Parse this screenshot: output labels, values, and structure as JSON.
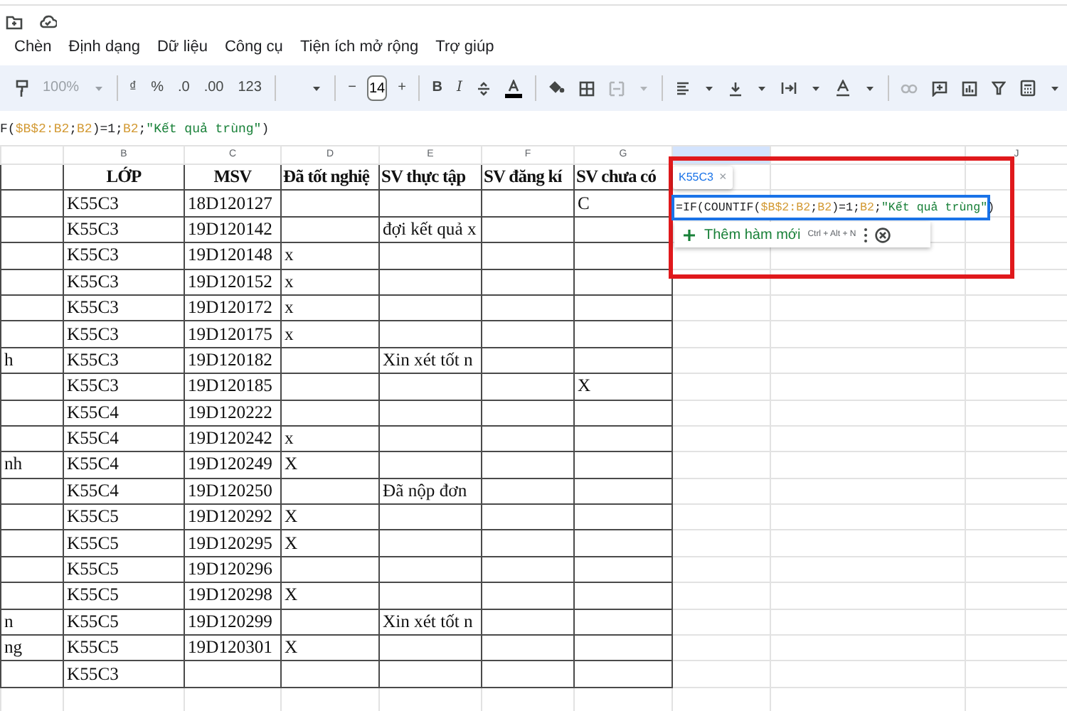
{
  "menu": [
    "Chèn",
    "Định dạng",
    "Dữ liệu",
    "Công cụ",
    "Tiện ích mở rộng",
    "Trợ giúp"
  ],
  "toolbar": {
    "zoom": "100%",
    "currency": "₫",
    "percent": "%",
    "decimal_decrease": ".0",
    "decimal_increase": ".00",
    "number_format": "123",
    "font_size_minus": "−",
    "font_size": "14",
    "font_size_plus": "+",
    "bold": "B",
    "italic": "I"
  },
  "formula_bar": {
    "segments": [
      {
        "kind": "plain",
        "text": "F("
      },
      {
        "kind": "ref",
        "text": "$B$2:B2"
      },
      {
        "kind": "plain",
        "text": ";"
      },
      {
        "kind": "ref",
        "text": "B2"
      },
      {
        "kind": "plain",
        "text": ")=1;"
      },
      {
        "kind": "ref",
        "text": "B2"
      },
      {
        "kind": "plain",
        "text": ";"
      },
      {
        "kind": "string",
        "text": "\"Kết quả trùng\""
      },
      {
        "kind": "plain",
        "text": ")"
      }
    ]
  },
  "column_headers": [
    {
      "letter": "B",
      "selected": false
    },
    {
      "letter": "C",
      "selected": false
    },
    {
      "letter": "D",
      "selected": false
    },
    {
      "letter": "E",
      "selected": false
    },
    {
      "letter": "F",
      "selected": false
    },
    {
      "letter": "G",
      "selected": false
    },
    {
      "selected": true
    },
    {
      "selected": false
    },
    {
      "letter": "J",
      "selected": false
    }
  ],
  "table": {
    "columns": [
      "LỚP",
      "MSV",
      "Đã tốt nghiệ",
      "SV thực tập",
      "SV đăng kí",
      "SV chưa có"
    ],
    "rows": [
      {
        "class": "K55C3",
        "msv": "18D120127",
        "column_7": "C"
      },
      {
        "class": "K55C3",
        "msv": "19D120142",
        "column_5": "đợi kết quả x"
      },
      {
        "class": "K55C3",
        "msv": "19D120148",
        "column_4": "x"
      },
      {
        "class": "K55C3",
        "msv": "19D120152",
        "column_4": "x"
      },
      {
        "class": "K55C3",
        "msv": "19D120172",
        "column_4": "x"
      },
      {
        "class": "K55C3",
        "msv": "19D120175",
        "column_4": "x"
      },
      {
        "column_1": "h",
        "class": "K55C3",
        "msv": "19D120182",
        "column_5": "Xin xét tốt n"
      },
      {
        "class": "K55C3",
        "msv": "19D120185",
        "column_7": "X"
      },
      {
        "class": "K55C4",
        "msv": "19D120222"
      },
      {
        "class": "K55C4",
        "msv": "19D120242",
        "column_4": "x"
      },
      {
        "column_1": "nh",
        "class": "K55C4",
        "msv": "19D120249",
        "column_4": "X"
      },
      {
        "class": "K55C4",
        "msv": "19D120250",
        "column_5": "Đã nộp đơn"
      },
      {
        "class": "K55C5",
        "msv": "19D120292",
        "column_4": "X"
      },
      {
        "class": "K55C5",
        "msv": "19D120295",
        "column_4": "X"
      },
      {
        "class": "K55C5",
        "msv": "19D120296"
      },
      {
        "class": "K55C5",
        "msv": "19D120298",
        "column_4": "X"
      },
      {
        "column_1": "n",
        "class": "K55C5",
        "msv": "19D120299",
        "column_5": "Xin xét tốt n"
      },
      {
        "column_1": "ng",
        "class": "K55C5",
        "msv": "19D120301",
        "column_4": "X"
      },
      {
        "class": "K55C3"
      }
    ]
  },
  "formula_popup": {
    "chip": "K55C3",
    "chip_close": "×",
    "segments": [
      {
        "kind": "plain",
        "text": "=IF(COUNTIF("
      },
      {
        "kind": "ref",
        "text": "$B$2:B2"
      },
      {
        "kind": "plain",
        "text": ";"
      },
      {
        "kind": "ref",
        "text": "B2"
      },
      {
        "kind": "plain",
        "text": ")=1;"
      },
      {
        "kind": "ref",
        "text": "B2"
      },
      {
        "kind": "plain",
        "text": ";"
      },
      {
        "kind": "string",
        "text": "\"Kết quả trùng\""
      },
      {
        "kind": "plain",
        "text": ")"
      }
    ],
    "suggestion": "Thêm hàm mới",
    "shortcut": "Ctrl + Alt + N"
  }
}
